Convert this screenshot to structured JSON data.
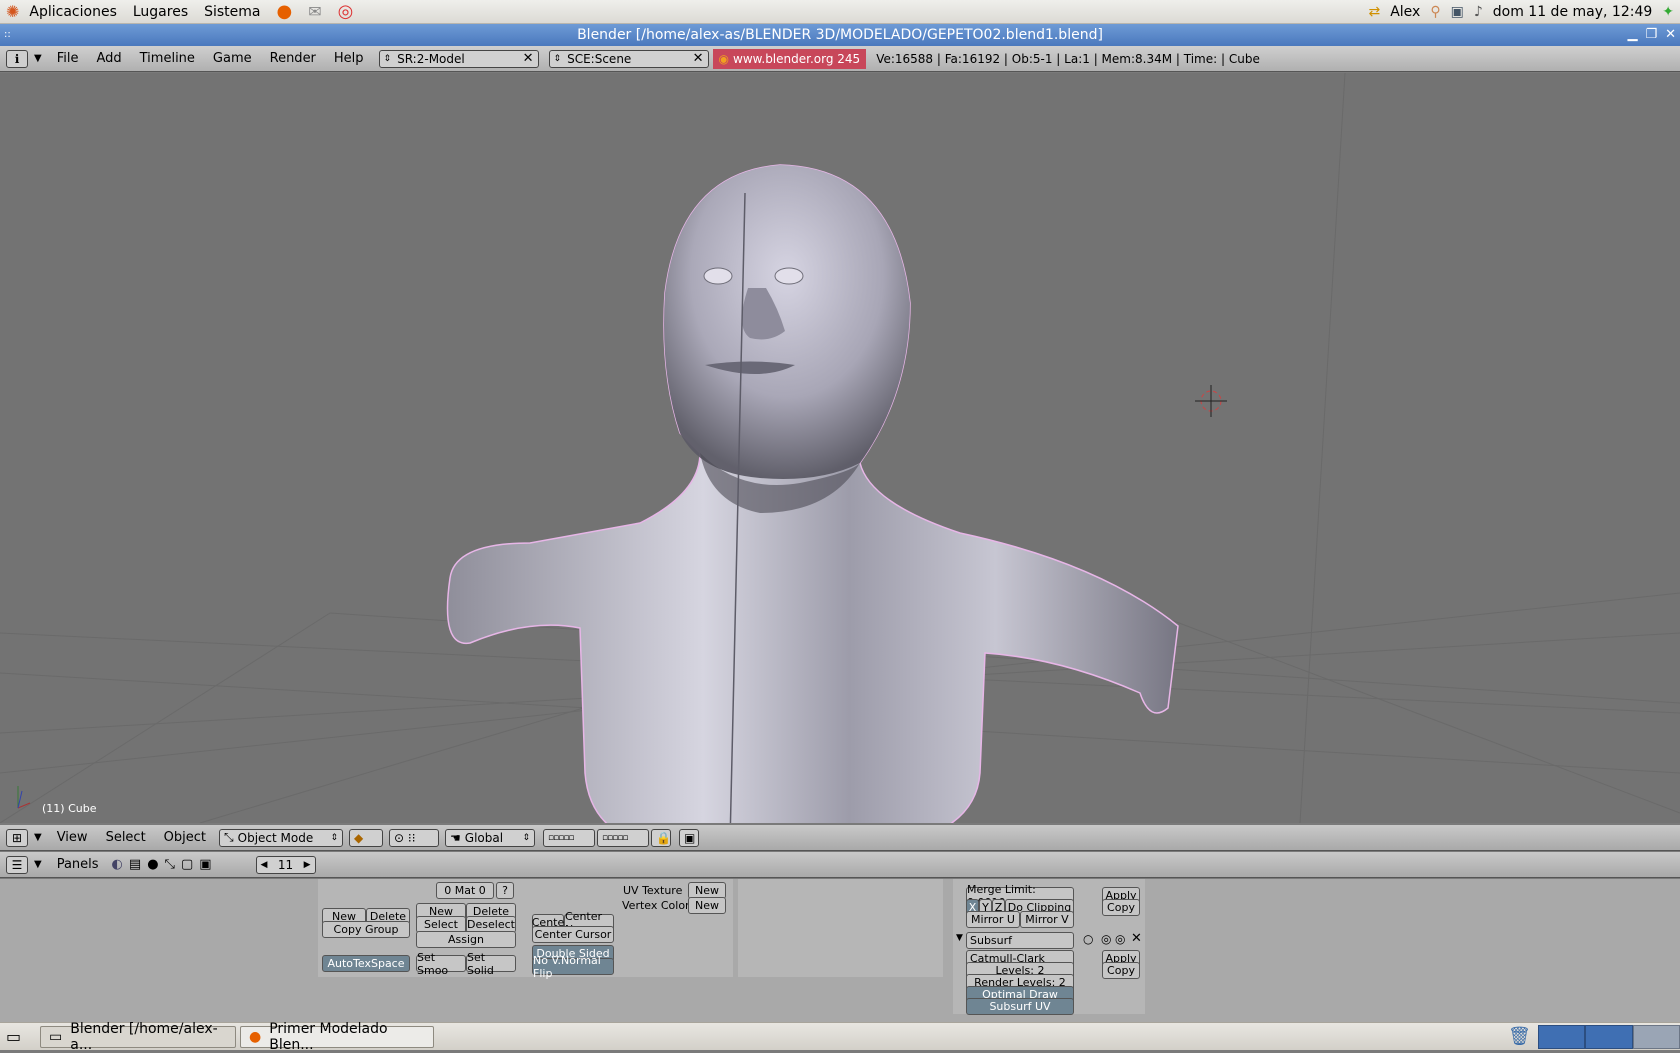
{
  "gnome_panel": {
    "menus": [
      "Aplicaciones",
      "Lugares",
      "Sistema"
    ],
    "user": "Alex",
    "datetime": "dom 11 de may, 12:49"
  },
  "window": {
    "title": "Blender [/home/alex-as/BLENDER 3D/MODELADO/GEPETO02.blend1.blend]"
  },
  "top_header": {
    "menus": [
      "File",
      "Add",
      "Timeline",
      "Game",
      "Render",
      "Help"
    ],
    "screen": "SR:2-Model",
    "scene": "SCE:Scene",
    "website": "www.blender.org 245",
    "stats": "Ve:16588 | Fa:16192 | Ob:5-1 | La:1  | Mem:8.34M  | Time: | Cube"
  },
  "viewport": {
    "object_label": "(11) Cube"
  },
  "view3d_header": {
    "menus": [
      "View",
      "Select",
      "Object"
    ],
    "mode": "Object Mode",
    "orientation": "Global"
  },
  "buttons_header": {
    "panels_label": "Panels",
    "frame": "11"
  },
  "link_panel": {
    "new": "New",
    "delete": "Delete",
    "copy_group": "Copy Group",
    "autotexspace": "AutoTexSpace"
  },
  "material_panel": {
    "mat": "0 Mat 0",
    "help": "?",
    "new": "New",
    "delete": "Delete",
    "select": "Select",
    "deselect": "Deselect",
    "assign": "Assign",
    "set_smooth": "Set Smoo",
    "set_solid": "Set Solid"
  },
  "mesh_panel": {
    "uv_texture": "UV Texture",
    "vertex_color": "Vertex Color",
    "new": "New",
    "centre": "Cente",
    "centre_new": "Center Ne",
    "center_cursor": "Center Cursor",
    "double_sided": "Double Sided",
    "no_vnormal_flip": "No V.Normal Flip"
  },
  "modifiers": {
    "mirror": {
      "merge_limit": "Merge Limit: 0.0010",
      "x": "X",
      "y": "Y",
      "z": "Z",
      "do_clipping": "Do Clipping",
      "mirror_u": "Mirror U",
      "mirror_v": "Mirror V",
      "apply": "Apply",
      "copy": "Copy"
    },
    "subsurf": {
      "name": "Subsurf",
      "type": "Catmull-Clark",
      "levels": "Levels: 2",
      "render_levels": "Render Levels: 2",
      "optimal_draw": "Optimal Draw",
      "subsurf_uv": "Subsurf UV",
      "apply": "Apply",
      "copy": "Copy"
    }
  },
  "taskbar": {
    "tasks": [
      "Blender [/home/alex-a...",
      "Primer Modelado Blen..."
    ]
  }
}
